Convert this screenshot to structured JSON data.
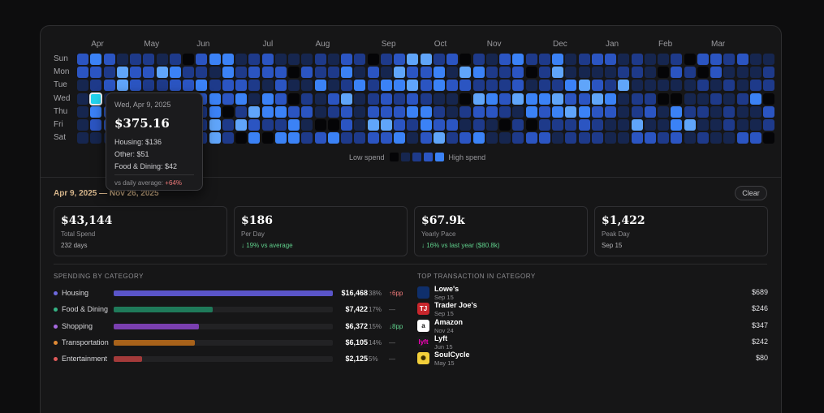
{
  "heatmap": {
    "months": [
      {
        "label": "Apr",
        "week": 1
      },
      {
        "label": "May",
        "week": 5
      },
      {
        "label": "Jun",
        "week": 9
      },
      {
        "label": "Jul",
        "week": 14
      },
      {
        "label": "Aug",
        "week": 18
      },
      {
        "label": "Sep",
        "week": 23
      },
      {
        "label": "Oct",
        "week": 27
      },
      {
        "label": "Nov",
        "week": 31
      },
      {
        "label": "Dec",
        "week": 36
      },
      {
        "label": "Jan",
        "week": 40
      },
      {
        "label": "Feb",
        "week": 44
      },
      {
        "label": "Mar",
        "week": 48
      }
    ],
    "days": [
      "Sun",
      "Mon",
      "Tue",
      "Wed",
      "Thu",
      "Fri",
      "Sat"
    ],
    "weeks": 53,
    "selected": {
      "week": 1,
      "day": 3
    },
    "legend": {
      "low": "Low spend",
      "high": "High spend"
    }
  },
  "tooltip": {
    "date": "Wed, Apr 9, 2025",
    "amount": "$375.16",
    "lines": [
      "Housing: $136",
      "Other: $51",
      "Food & Dining: $42"
    ],
    "avg_label": "vs daily average:",
    "avg_value": "+64%"
  },
  "range": {
    "label": "Apr 9, 2025 — Nov 26, 2025",
    "clear": "Clear"
  },
  "stats": [
    {
      "value": "$43,144",
      "label": "Total Spend",
      "sub": "232 days",
      "positive": false
    },
    {
      "value": "$186",
      "label": "Per Day",
      "sub": "↓ 19% vs average",
      "positive": true
    },
    {
      "value": "$67.9k",
      "label": "Yearly Pace",
      "sub": "↓ 16% vs last year ($80.8k)",
      "positive": true
    },
    {
      "value": "$1,422",
      "label": "Peak Day",
      "sub": "Sep 15",
      "positive": false
    }
  ],
  "categories_title": "SPENDING BY CATEGORY",
  "categories": [
    {
      "name": "Housing",
      "amount": "$16,468",
      "pct": "38%",
      "change": "↑6pp",
      "share": 1.0,
      "color": "#5a55c9",
      "dot": "#6e6ae0",
      "change_color": "#f07a7a"
    },
    {
      "name": "Food & Dining",
      "amount": "$7,422",
      "pct": "17%",
      "change": "—",
      "share": 0.45,
      "color": "#1f7a5a",
      "dot": "#35b485",
      "change_color": "#7a7a7e"
    },
    {
      "name": "Shopping",
      "amount": "$6,372",
      "pct": "15%",
      "change": "↓8pp",
      "share": 0.39,
      "color": "#7a3fb0",
      "dot": "#a76ae0",
      "change_color": "#5fcf8b"
    },
    {
      "name": "Transportation",
      "amount": "$6,105",
      "pct": "14%",
      "change": "—",
      "share": 0.37,
      "color": "#a8621a",
      "dot": "#e08a35",
      "change_color": "#7a7a7e"
    },
    {
      "name": "Entertainment",
      "amount": "$2,125",
      "pct": "5%",
      "change": "—",
      "share": 0.13,
      "color": "#a33a3a",
      "dot": "#e05a5a",
      "change_color": "#7a7a7e"
    }
  ],
  "transactions_title": "TOP TRANSACTION IN CATEGORY",
  "transactions": [
    {
      "name": "Lowe's",
      "date": "Sep 15",
      "amount": "$689",
      "icon": "lowes-logo-icon",
      "glyph": "",
      "bg": "#0f2f6b",
      "fg": "#ffffff"
    },
    {
      "name": "Trader Joe's",
      "date": "Sep 15",
      "amount": "$246",
      "icon": "trader-joes-logo-icon",
      "glyph": "TJ",
      "bg": "#c8262c",
      "fg": "#ffffff"
    },
    {
      "name": "Amazon",
      "date": "Nov 24",
      "amount": "$347",
      "icon": "amazon-logo-icon",
      "glyph": "a",
      "bg": "#ffffff",
      "fg": "#111111"
    },
    {
      "name": "Lyft",
      "date": "Jun 15",
      "amount": "$242",
      "icon": "lyft-logo-icon",
      "glyph": "lyft",
      "bg": "#1a1a1c",
      "fg": "#ff00bf"
    },
    {
      "name": "SoulCycle",
      "date": "May 15",
      "amount": "$80",
      "icon": "soulcycle-logo-icon",
      "glyph": "✺",
      "bg": "#f2cf3a",
      "fg": "#3a2e00"
    }
  ],
  "colors": {
    "accent": "#3b82f6",
    "selected": "#22d3ee",
    "level0": "#050507",
    "level1": "#16264f",
    "level2": "#1e3a8a",
    "level3": "#2b55c2",
    "level4": "#3b82f6",
    "level5": "#60a5fa"
  }
}
